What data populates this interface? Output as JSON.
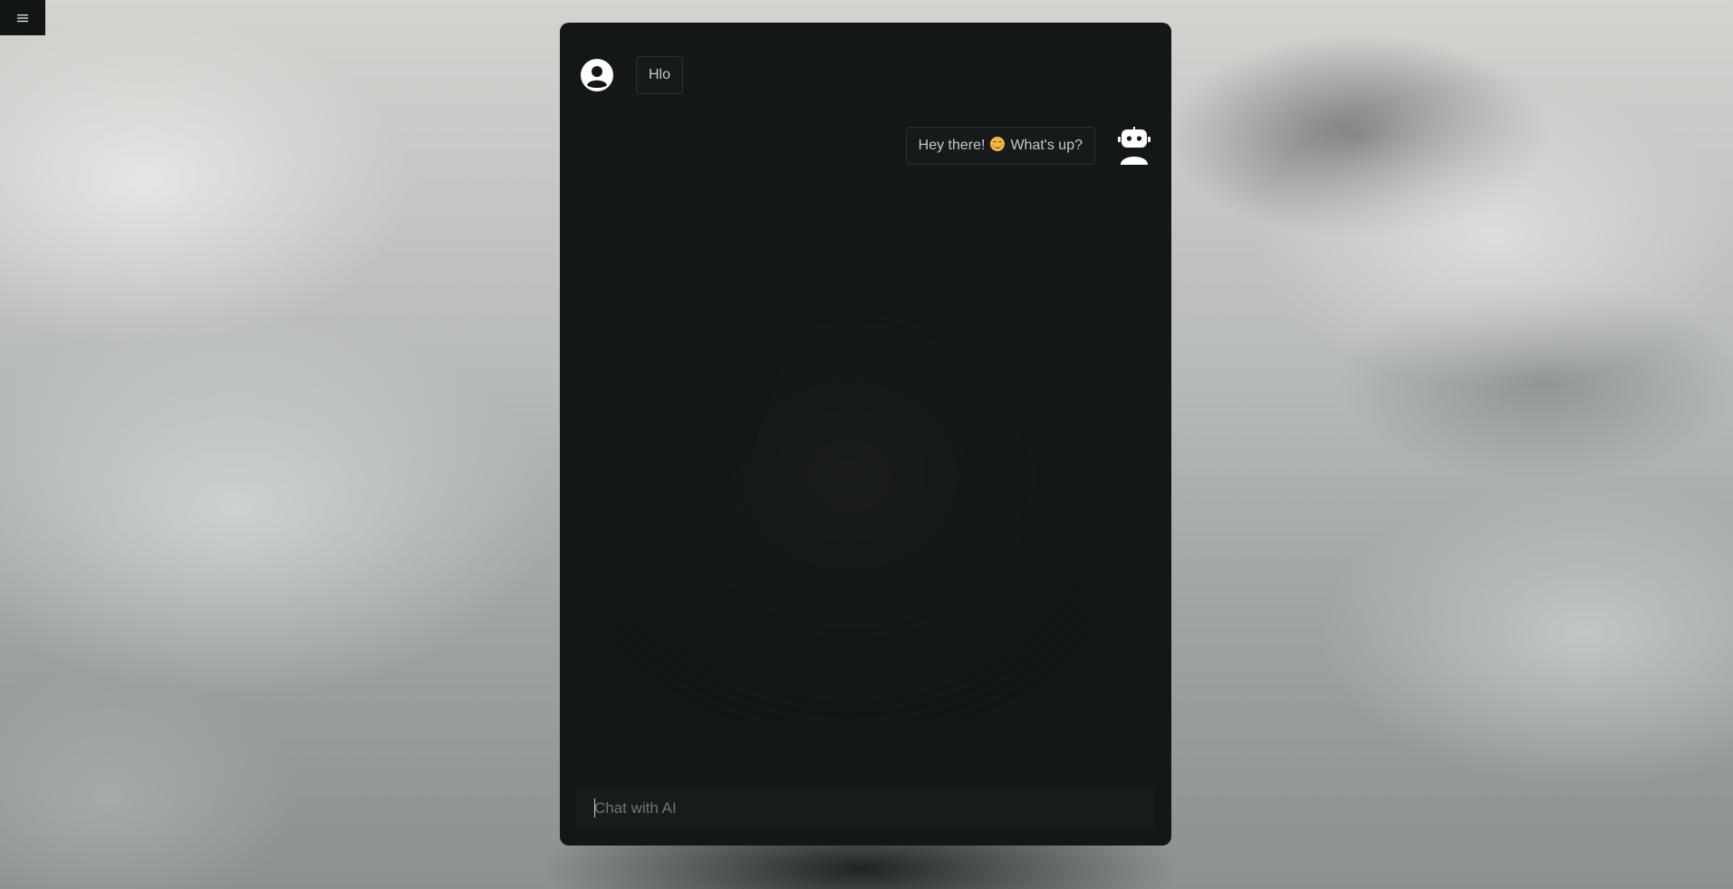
{
  "menu": {
    "icon": "hamburger-menu-icon"
  },
  "chat": {
    "messages": [
      {
        "sender": "user",
        "avatar_icon": "user-circle-icon",
        "text": "Hlo"
      },
      {
        "sender": "bot",
        "avatar_icon": "robot-icon",
        "text_before_emoji": "Hey there!",
        "emoji": "smiling-face-emoji",
        "text_after_emoji": "What's up?"
      }
    ]
  },
  "input": {
    "placeholder": "Chat with AI",
    "value": ""
  },
  "colors": {
    "panel_background": "#131718",
    "bubble_border": "#2b3133",
    "text": "#c7cacb"
  }
}
